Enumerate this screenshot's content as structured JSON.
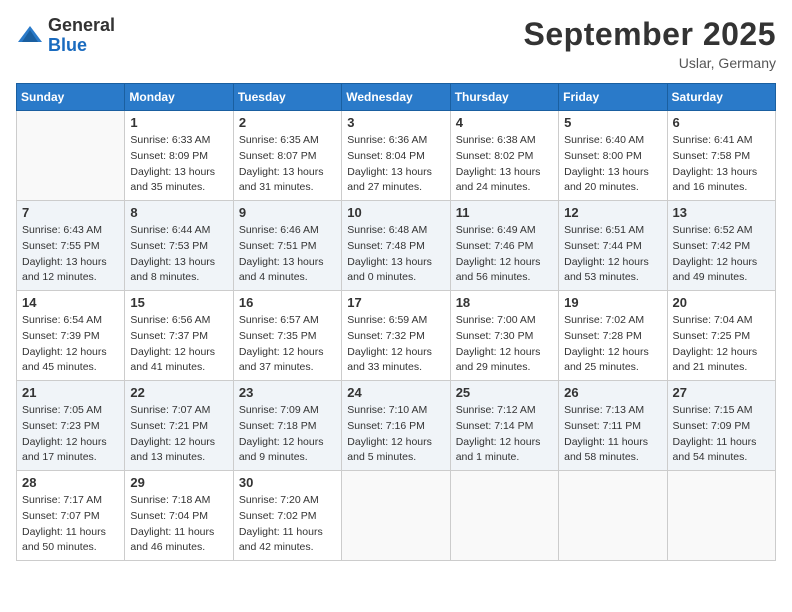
{
  "header": {
    "logo_general": "General",
    "logo_blue": "Blue",
    "month_title": "September 2025",
    "location": "Uslar, Germany"
  },
  "days_of_week": [
    "Sunday",
    "Monday",
    "Tuesday",
    "Wednesday",
    "Thursday",
    "Friday",
    "Saturday"
  ],
  "weeks": [
    [
      {
        "day": "",
        "info": ""
      },
      {
        "day": "1",
        "info": "Sunrise: 6:33 AM\nSunset: 8:09 PM\nDaylight: 13 hours\nand 35 minutes."
      },
      {
        "day": "2",
        "info": "Sunrise: 6:35 AM\nSunset: 8:07 PM\nDaylight: 13 hours\nand 31 minutes."
      },
      {
        "day": "3",
        "info": "Sunrise: 6:36 AM\nSunset: 8:04 PM\nDaylight: 13 hours\nand 27 minutes."
      },
      {
        "day": "4",
        "info": "Sunrise: 6:38 AM\nSunset: 8:02 PM\nDaylight: 13 hours\nand 24 minutes."
      },
      {
        "day": "5",
        "info": "Sunrise: 6:40 AM\nSunset: 8:00 PM\nDaylight: 13 hours\nand 20 minutes."
      },
      {
        "day": "6",
        "info": "Sunrise: 6:41 AM\nSunset: 7:58 PM\nDaylight: 13 hours\nand 16 minutes."
      }
    ],
    [
      {
        "day": "7",
        "info": "Sunrise: 6:43 AM\nSunset: 7:55 PM\nDaylight: 13 hours\nand 12 minutes."
      },
      {
        "day": "8",
        "info": "Sunrise: 6:44 AM\nSunset: 7:53 PM\nDaylight: 13 hours\nand 8 minutes."
      },
      {
        "day": "9",
        "info": "Sunrise: 6:46 AM\nSunset: 7:51 PM\nDaylight: 13 hours\nand 4 minutes."
      },
      {
        "day": "10",
        "info": "Sunrise: 6:48 AM\nSunset: 7:48 PM\nDaylight: 13 hours\nand 0 minutes."
      },
      {
        "day": "11",
        "info": "Sunrise: 6:49 AM\nSunset: 7:46 PM\nDaylight: 12 hours\nand 56 minutes."
      },
      {
        "day": "12",
        "info": "Sunrise: 6:51 AM\nSunset: 7:44 PM\nDaylight: 12 hours\nand 53 minutes."
      },
      {
        "day": "13",
        "info": "Sunrise: 6:52 AM\nSunset: 7:42 PM\nDaylight: 12 hours\nand 49 minutes."
      }
    ],
    [
      {
        "day": "14",
        "info": "Sunrise: 6:54 AM\nSunset: 7:39 PM\nDaylight: 12 hours\nand 45 minutes."
      },
      {
        "day": "15",
        "info": "Sunrise: 6:56 AM\nSunset: 7:37 PM\nDaylight: 12 hours\nand 41 minutes."
      },
      {
        "day": "16",
        "info": "Sunrise: 6:57 AM\nSunset: 7:35 PM\nDaylight: 12 hours\nand 37 minutes."
      },
      {
        "day": "17",
        "info": "Sunrise: 6:59 AM\nSunset: 7:32 PM\nDaylight: 12 hours\nand 33 minutes."
      },
      {
        "day": "18",
        "info": "Sunrise: 7:00 AM\nSunset: 7:30 PM\nDaylight: 12 hours\nand 29 minutes."
      },
      {
        "day": "19",
        "info": "Sunrise: 7:02 AM\nSunset: 7:28 PM\nDaylight: 12 hours\nand 25 minutes."
      },
      {
        "day": "20",
        "info": "Sunrise: 7:04 AM\nSunset: 7:25 PM\nDaylight: 12 hours\nand 21 minutes."
      }
    ],
    [
      {
        "day": "21",
        "info": "Sunrise: 7:05 AM\nSunset: 7:23 PM\nDaylight: 12 hours\nand 17 minutes."
      },
      {
        "day": "22",
        "info": "Sunrise: 7:07 AM\nSunset: 7:21 PM\nDaylight: 12 hours\nand 13 minutes."
      },
      {
        "day": "23",
        "info": "Sunrise: 7:09 AM\nSunset: 7:18 PM\nDaylight: 12 hours\nand 9 minutes."
      },
      {
        "day": "24",
        "info": "Sunrise: 7:10 AM\nSunset: 7:16 PM\nDaylight: 12 hours\nand 5 minutes."
      },
      {
        "day": "25",
        "info": "Sunrise: 7:12 AM\nSunset: 7:14 PM\nDaylight: 12 hours\nand 1 minute."
      },
      {
        "day": "26",
        "info": "Sunrise: 7:13 AM\nSunset: 7:11 PM\nDaylight: 11 hours\nand 58 minutes."
      },
      {
        "day": "27",
        "info": "Sunrise: 7:15 AM\nSunset: 7:09 PM\nDaylight: 11 hours\nand 54 minutes."
      }
    ],
    [
      {
        "day": "28",
        "info": "Sunrise: 7:17 AM\nSunset: 7:07 PM\nDaylight: 11 hours\nand 50 minutes."
      },
      {
        "day": "29",
        "info": "Sunrise: 7:18 AM\nSunset: 7:04 PM\nDaylight: 11 hours\nand 46 minutes."
      },
      {
        "day": "30",
        "info": "Sunrise: 7:20 AM\nSunset: 7:02 PM\nDaylight: 11 hours\nand 42 minutes."
      },
      {
        "day": "",
        "info": ""
      },
      {
        "day": "",
        "info": ""
      },
      {
        "day": "",
        "info": ""
      },
      {
        "day": "",
        "info": ""
      }
    ]
  ]
}
